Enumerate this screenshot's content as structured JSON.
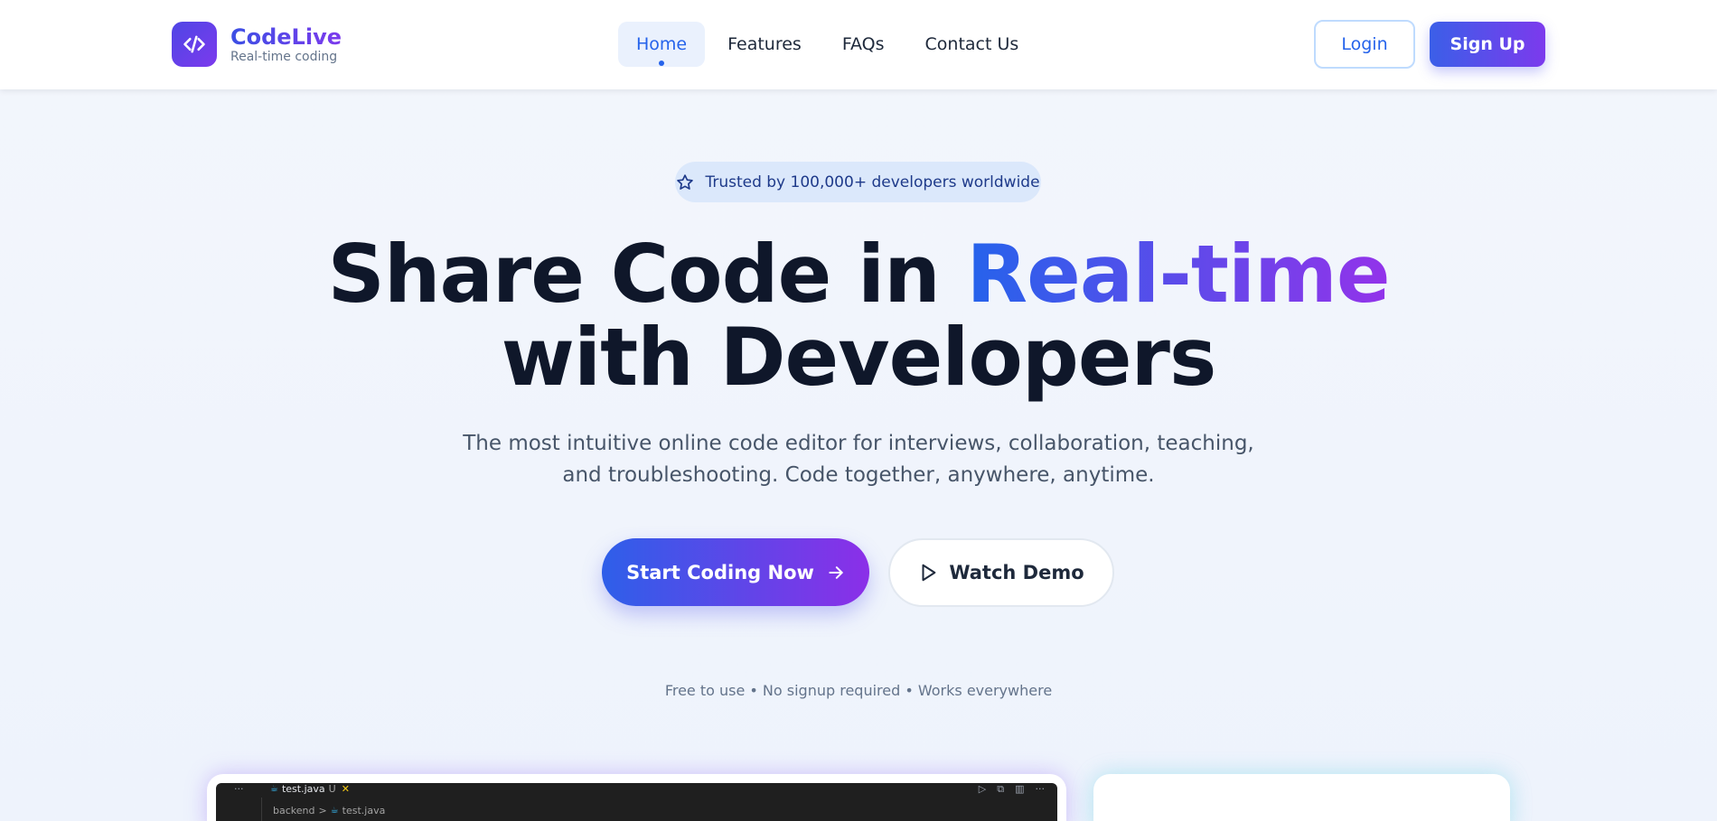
{
  "brand": {
    "name": "CodeLive",
    "tagline": "Real-time coding",
    "icon": "code-icon"
  },
  "nav": {
    "links": [
      {
        "label": "Home",
        "active": true
      },
      {
        "label": "Features",
        "active": false
      },
      {
        "label": "FAQs",
        "active": false
      },
      {
        "label": "Contact Us",
        "active": false
      }
    ],
    "login_label": "Login",
    "signup_label": "Sign Up"
  },
  "hero": {
    "badge_text": "Trusted by 100,000+ developers worldwide",
    "badge_icon": "star-icon",
    "headline_part1": "Share Code in ",
    "headline_highlight": "Real-time",
    "headline_line2": "with Developers",
    "subtitle": "The most intuitive online code editor for interviews, collaboration, teaching, and troubleshooting. Code together, anywhere, anytime.",
    "primary_cta": "Start Coding Now",
    "secondary_cta": "Watch Demo",
    "note": "Free to use • No signup required • Works everywhere"
  },
  "preview": {
    "editor": {
      "dots": "···",
      "tab_file": "test.java",
      "tab_status": "U",
      "tab_close": "✕",
      "breadcrumb_folder": "backend",
      "breadcrumb_sep": ">",
      "breadcrumb_file": "test.java"
    }
  },
  "colors": {
    "accent_blue": "#2563eb",
    "accent_purple": "#7c3aed",
    "text_dark": "#0f172a",
    "text_muted": "#64748b"
  }
}
